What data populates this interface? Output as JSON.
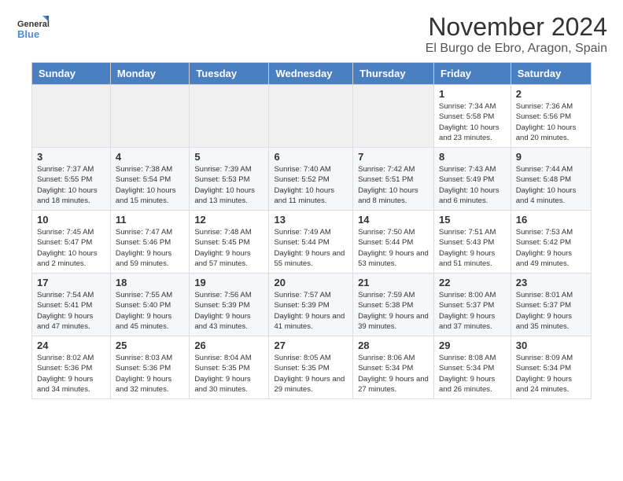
{
  "header": {
    "logo_line1": "General",
    "logo_line2": "Blue",
    "month": "November 2024",
    "location": "El Burgo de Ebro, Aragon, Spain"
  },
  "weekdays": [
    "Sunday",
    "Monday",
    "Tuesday",
    "Wednesday",
    "Thursday",
    "Friday",
    "Saturday"
  ],
  "weeks": [
    [
      {
        "day": "",
        "info": ""
      },
      {
        "day": "",
        "info": ""
      },
      {
        "day": "",
        "info": ""
      },
      {
        "day": "",
        "info": ""
      },
      {
        "day": "",
        "info": ""
      },
      {
        "day": "1",
        "info": "Sunrise: 7:34 AM\nSunset: 5:58 PM\nDaylight: 10 hours and 23 minutes."
      },
      {
        "day": "2",
        "info": "Sunrise: 7:36 AM\nSunset: 5:56 PM\nDaylight: 10 hours and 20 minutes."
      }
    ],
    [
      {
        "day": "3",
        "info": "Sunrise: 7:37 AM\nSunset: 5:55 PM\nDaylight: 10 hours and 18 minutes."
      },
      {
        "day": "4",
        "info": "Sunrise: 7:38 AM\nSunset: 5:54 PM\nDaylight: 10 hours and 15 minutes."
      },
      {
        "day": "5",
        "info": "Sunrise: 7:39 AM\nSunset: 5:53 PM\nDaylight: 10 hours and 13 minutes."
      },
      {
        "day": "6",
        "info": "Sunrise: 7:40 AM\nSunset: 5:52 PM\nDaylight: 10 hours and 11 minutes."
      },
      {
        "day": "7",
        "info": "Sunrise: 7:42 AM\nSunset: 5:51 PM\nDaylight: 10 hours and 8 minutes."
      },
      {
        "day": "8",
        "info": "Sunrise: 7:43 AM\nSunset: 5:49 PM\nDaylight: 10 hours and 6 minutes."
      },
      {
        "day": "9",
        "info": "Sunrise: 7:44 AM\nSunset: 5:48 PM\nDaylight: 10 hours and 4 minutes."
      }
    ],
    [
      {
        "day": "10",
        "info": "Sunrise: 7:45 AM\nSunset: 5:47 PM\nDaylight: 10 hours and 2 minutes."
      },
      {
        "day": "11",
        "info": "Sunrise: 7:47 AM\nSunset: 5:46 PM\nDaylight: 9 hours and 59 minutes."
      },
      {
        "day": "12",
        "info": "Sunrise: 7:48 AM\nSunset: 5:45 PM\nDaylight: 9 hours and 57 minutes."
      },
      {
        "day": "13",
        "info": "Sunrise: 7:49 AM\nSunset: 5:44 PM\nDaylight: 9 hours and 55 minutes."
      },
      {
        "day": "14",
        "info": "Sunrise: 7:50 AM\nSunset: 5:44 PM\nDaylight: 9 hours and 53 minutes."
      },
      {
        "day": "15",
        "info": "Sunrise: 7:51 AM\nSunset: 5:43 PM\nDaylight: 9 hours and 51 minutes."
      },
      {
        "day": "16",
        "info": "Sunrise: 7:53 AM\nSunset: 5:42 PM\nDaylight: 9 hours and 49 minutes."
      }
    ],
    [
      {
        "day": "17",
        "info": "Sunrise: 7:54 AM\nSunset: 5:41 PM\nDaylight: 9 hours and 47 minutes."
      },
      {
        "day": "18",
        "info": "Sunrise: 7:55 AM\nSunset: 5:40 PM\nDaylight: 9 hours and 45 minutes."
      },
      {
        "day": "19",
        "info": "Sunrise: 7:56 AM\nSunset: 5:39 PM\nDaylight: 9 hours and 43 minutes."
      },
      {
        "day": "20",
        "info": "Sunrise: 7:57 AM\nSunset: 5:39 PM\nDaylight: 9 hours and 41 minutes."
      },
      {
        "day": "21",
        "info": "Sunrise: 7:59 AM\nSunset: 5:38 PM\nDaylight: 9 hours and 39 minutes."
      },
      {
        "day": "22",
        "info": "Sunrise: 8:00 AM\nSunset: 5:37 PM\nDaylight: 9 hours and 37 minutes."
      },
      {
        "day": "23",
        "info": "Sunrise: 8:01 AM\nSunset: 5:37 PM\nDaylight: 9 hours and 35 minutes."
      }
    ],
    [
      {
        "day": "24",
        "info": "Sunrise: 8:02 AM\nSunset: 5:36 PM\nDaylight: 9 hours and 34 minutes."
      },
      {
        "day": "25",
        "info": "Sunrise: 8:03 AM\nSunset: 5:36 PM\nDaylight: 9 hours and 32 minutes."
      },
      {
        "day": "26",
        "info": "Sunrise: 8:04 AM\nSunset: 5:35 PM\nDaylight: 9 hours and 30 minutes."
      },
      {
        "day": "27",
        "info": "Sunrise: 8:05 AM\nSunset: 5:35 PM\nDaylight: 9 hours and 29 minutes."
      },
      {
        "day": "28",
        "info": "Sunrise: 8:06 AM\nSunset: 5:34 PM\nDaylight: 9 hours and 27 minutes."
      },
      {
        "day": "29",
        "info": "Sunrise: 8:08 AM\nSunset: 5:34 PM\nDaylight: 9 hours and 26 minutes."
      },
      {
        "day": "30",
        "info": "Sunrise: 8:09 AM\nSunset: 5:34 PM\nDaylight: 9 hours and 24 minutes."
      }
    ]
  ]
}
